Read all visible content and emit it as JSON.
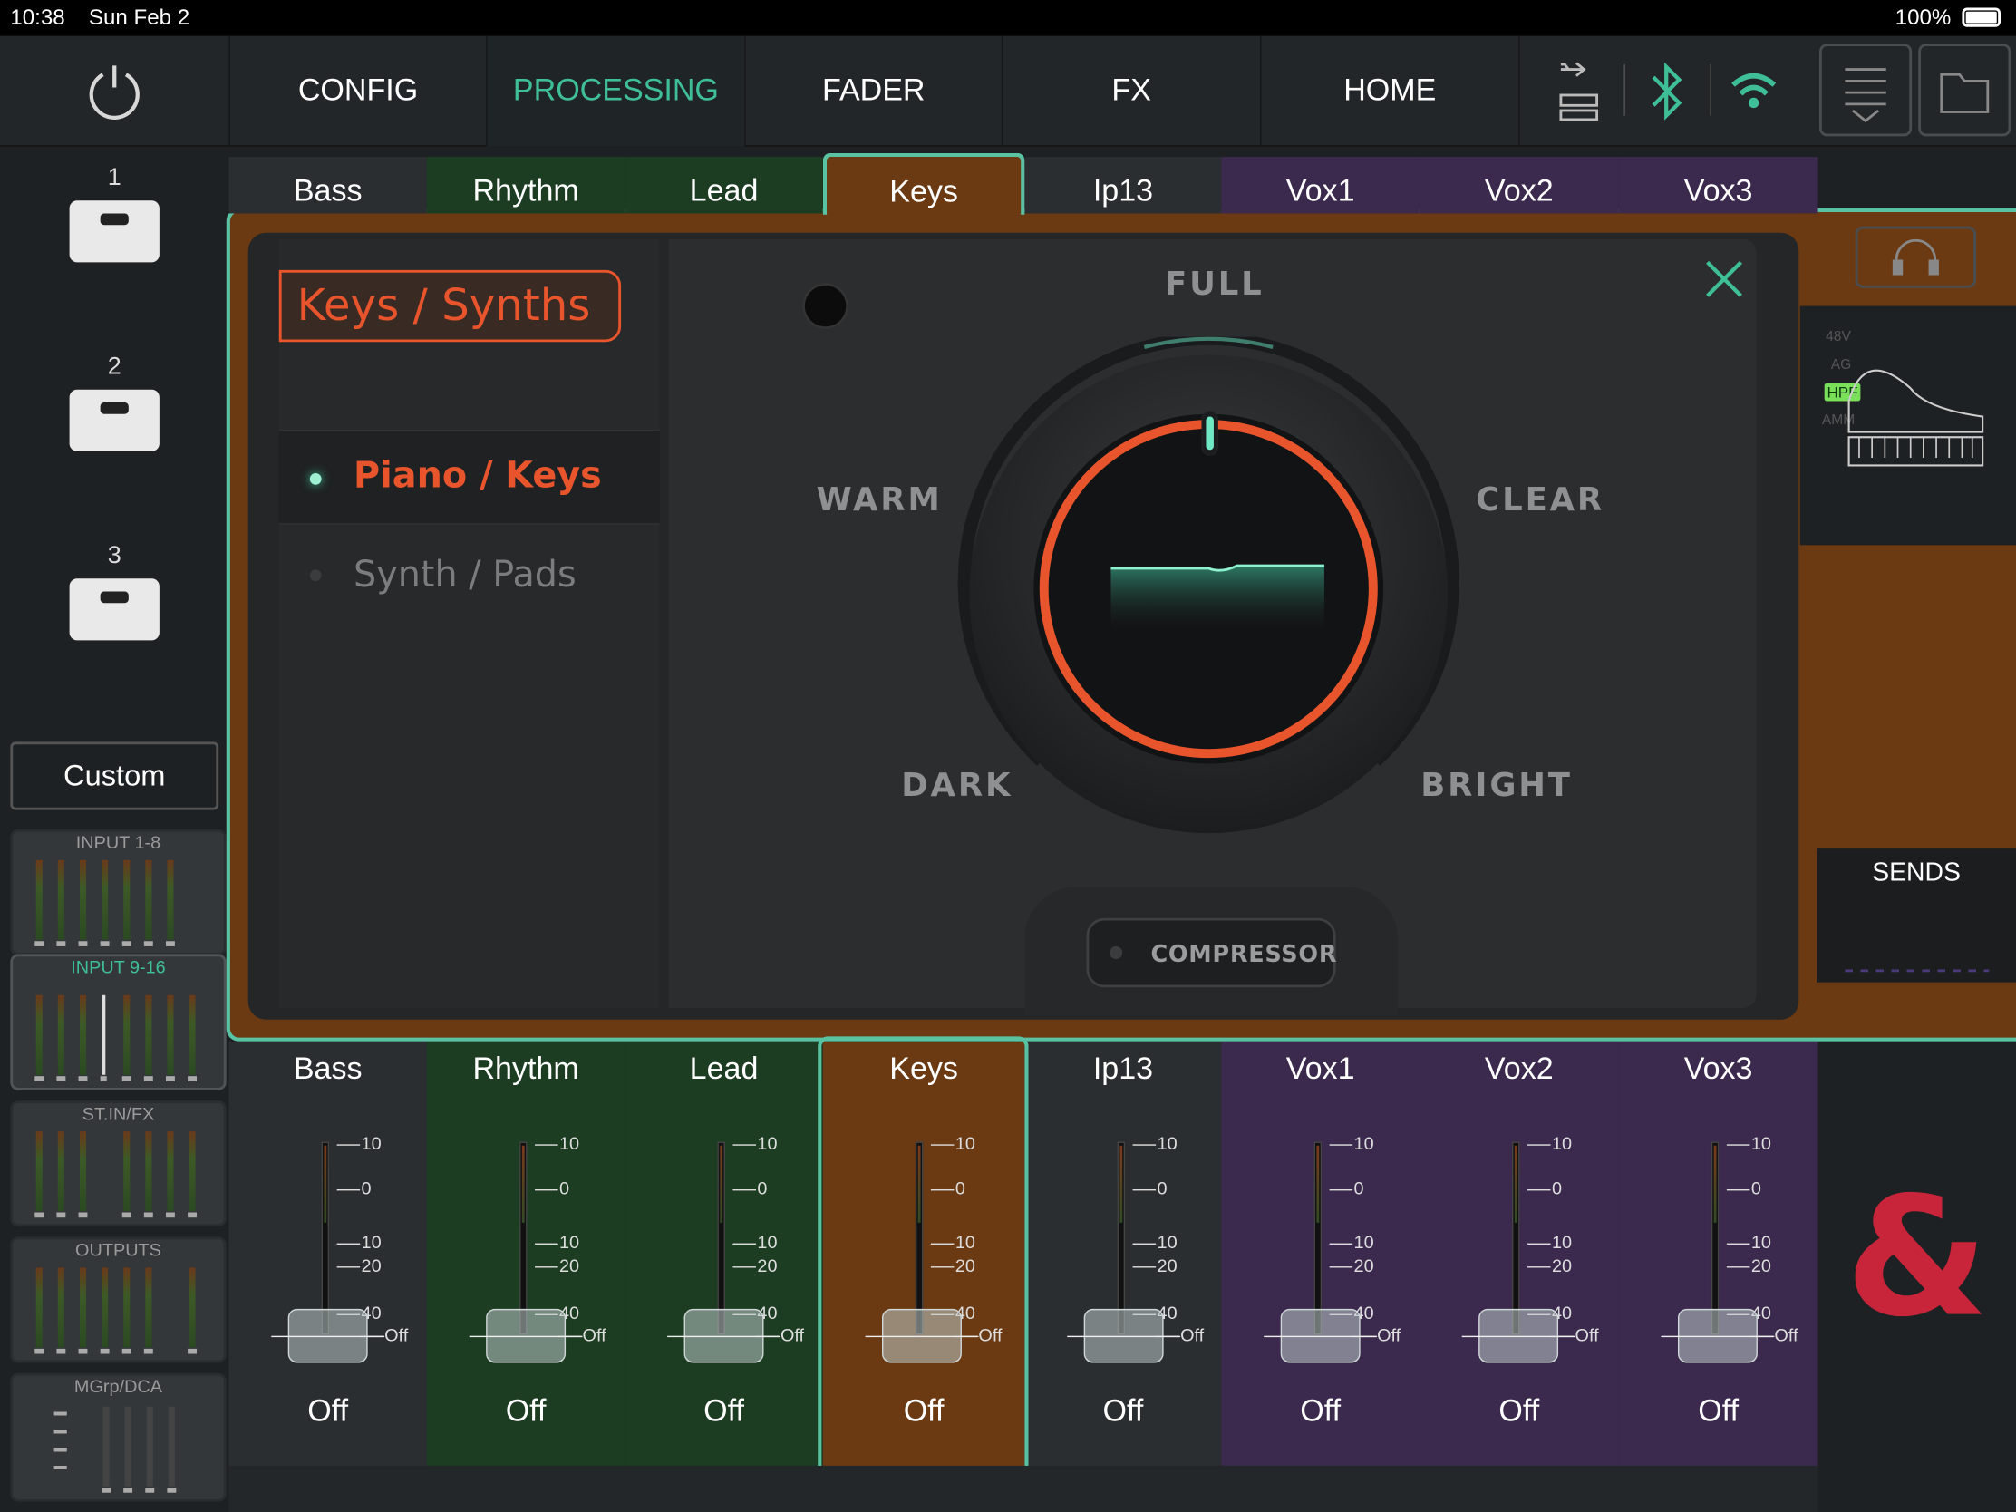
{
  "status": {
    "time": "10:38",
    "date": "Sun Feb 2",
    "battery": "100%"
  },
  "nav": {
    "tabs": [
      "CONFIG",
      "PROCESSING",
      "FADER",
      "FX",
      "HOME"
    ],
    "active": "PROCESSING",
    "icons": [
      "power-icon",
      "usb-sd-icon",
      "bluetooth-icon",
      "wifi-icon",
      "menu-icon",
      "folder-icon"
    ]
  },
  "scenes": [
    "1",
    "2",
    "3"
  ],
  "custom_label": "Custom",
  "banks": [
    "INPUT 1-8",
    "INPUT 9-16",
    "ST.IN/FX",
    "OUTPUTS",
    "MGrp/DCA"
  ],
  "selected_bank": "INPUT 9-16",
  "channels": [
    {
      "name": "Bass",
      "color": "#2b2e30",
      "value": "Off"
    },
    {
      "name": "Rhythm",
      "color": "#1c3d22",
      "value": "Off"
    },
    {
      "name": "Lead",
      "color": "#1c3d22",
      "value": "Off"
    },
    {
      "name": "Keys",
      "color": "#6b3a12",
      "value": "Off"
    },
    {
      "name": "Ip13",
      "color": "#2b2e30",
      "value": "Off"
    },
    {
      "name": "Vox1",
      "color": "#3b2a4e",
      "value": "Off"
    },
    {
      "name": "Vox2",
      "color": "#3b2a4e",
      "value": "Off"
    },
    {
      "name": "Vox3",
      "color": "#3b2a4e",
      "value": "Off"
    }
  ],
  "selected_channel": "Keys",
  "fader_scale": [
    "10",
    "0",
    "10",
    "20",
    "40",
    "Off"
  ],
  "processing": {
    "category": "Keys / Synths",
    "options": [
      "Piano / Keys",
      "Synth / Pads"
    ],
    "selected_option": "Piano / Keys",
    "tone_labels": {
      "top": "FULL",
      "left": "WARM",
      "right": "CLEAR",
      "bottom_left": "DARK",
      "bottom_right": "BRIGHT"
    },
    "compressor_label": "COMPRESSOR"
  },
  "side": {
    "badges": [
      "48V",
      "AG",
      "HPF",
      "AMM"
    ],
    "active_badge": "HPF",
    "sends_label": "SENDS"
  },
  "colors": {
    "accent": "#3fbf95",
    "orange": "#e8552d",
    "keys": "#6b3a12",
    "green_group": "#1c3d22",
    "purple_group": "#3b2a4e",
    "logo": "#c8253a"
  }
}
